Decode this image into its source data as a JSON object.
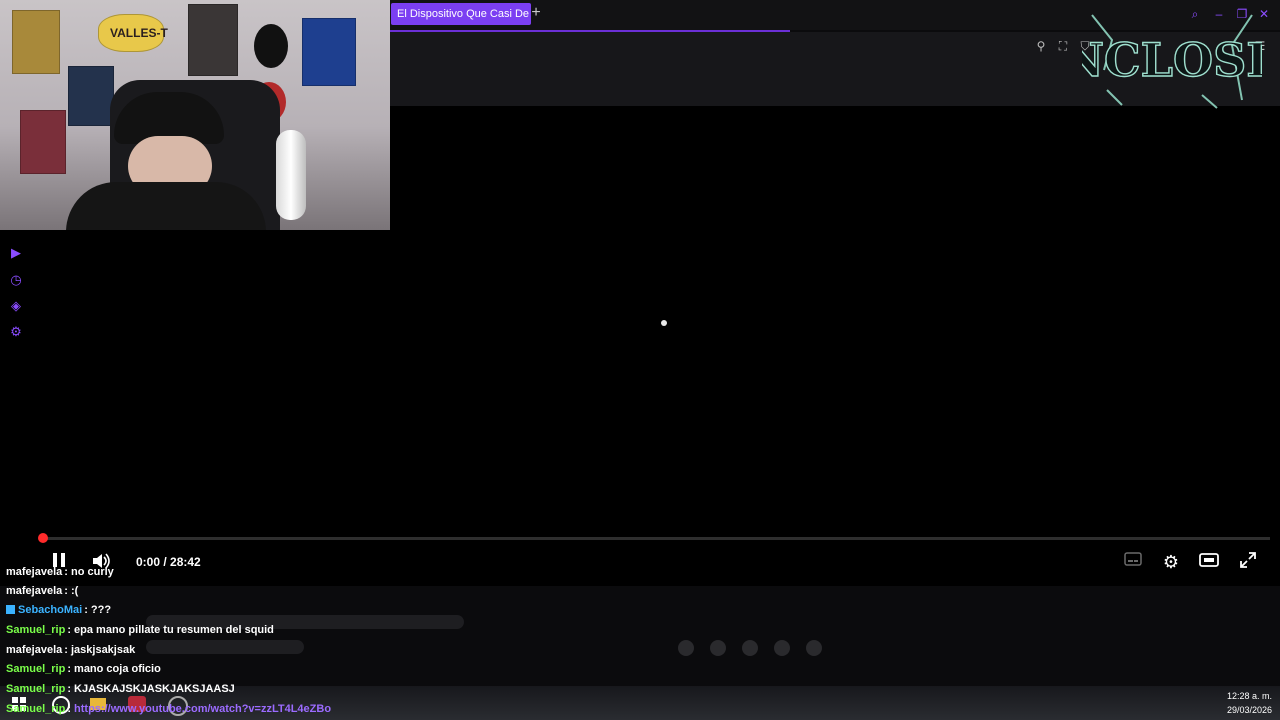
{
  "webcam": {
    "shirt_text": "VALLES-T"
  },
  "browser": {
    "tab_title": "El Dispositivo Que Casi De",
    "new_tab": "+",
    "logo_text": "INCLOSIV"
  },
  "video": {
    "time": "0:00 / 28:42",
    "progress": 0.0,
    "state": "loading"
  },
  "chat": {
    "messages": [
      {
        "user": "mafejavela",
        "text": ": no curly",
        "color": "#ffffff"
      },
      {
        "user": "mafejavela",
        "text": ": :(",
        "color": "#ffffff"
      },
      {
        "user": "SebachoMai",
        "text": ": ???",
        "color": "#3bb3ff"
      },
      {
        "user": "Samuel_rip",
        "text": ": epa mano pillate tu resumen del squid",
        "color": "#7bff4a"
      },
      {
        "user": "mafejavela",
        "text": ": jaskjsakjsak",
        "color": "#ffffff"
      },
      {
        "user": "Samuel_rip",
        "text": ": mano coja oficio",
        "color": "#7bff4a"
      },
      {
        "user": "Samuel_rip",
        "text": ": KJASKAJSKJASKJAKSJAASJ",
        "color": "#7bff4a"
      },
      {
        "user": "Samuel_rip",
        "text": ": ",
        "link": "https://www.youtube.com/watch?v=zzLT4L4eZBo",
        "color": "#7bff4a"
      }
    ]
  },
  "taskbar": {
    "time": "12:28 a. m.",
    "date": "29/03/2026"
  },
  "colors": {
    "accent": "#7b3ff2",
    "progress": "#ff2b2b",
    "user_green": "#7bff4a",
    "user_blue": "#3bb3ff"
  }
}
